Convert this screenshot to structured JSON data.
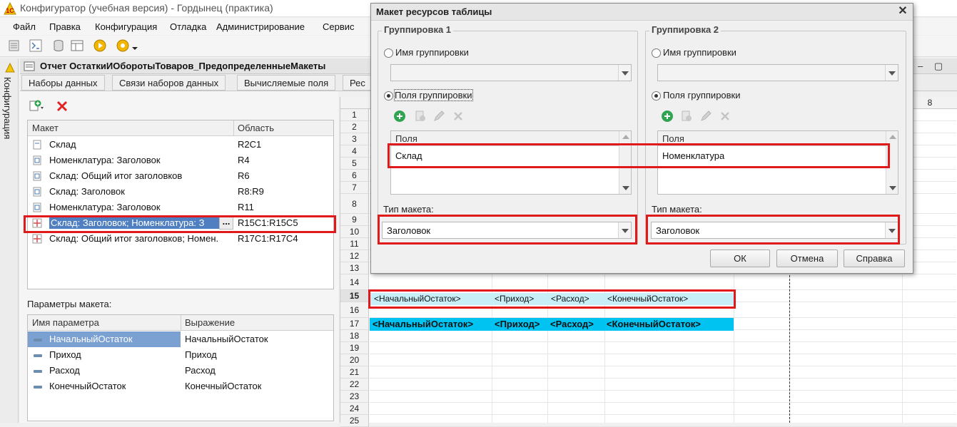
{
  "app": {
    "title": "Конфигуратор (учебная версия) - Гордынец (практика)"
  },
  "menu": [
    "Файл",
    "Правка",
    "Конфигурация",
    "Отладка",
    "Администрирование",
    "Сервис"
  ],
  "side_panel": {
    "label": "Конфигурация"
  },
  "document": {
    "title": "Отчет ОстаткиИОборотыТоваров_ПредопределенныеМакеты",
    "tabs": [
      "Наборы данных",
      "Связи наборов данных",
      "Вычисляемые поля",
      "Рес"
    ]
  },
  "layouts": {
    "columns": [
      "Макет",
      "Область"
    ],
    "rows": [
      {
        "name": "Склад",
        "area": "R2C1"
      },
      {
        "name": "Номенклатура: Заголовок",
        "area": "R4"
      },
      {
        "name": "Склад: Общий итог заголовков",
        "area": "R6"
      },
      {
        "name": "Склад: Заголовок",
        "area": "R8:R9"
      },
      {
        "name": "Номенклатура: Заголовок",
        "area": "R11"
      },
      {
        "name": "Склад: Заголовок; Номенклатура: З",
        "area": "R15C1:R15C5",
        "selected": true
      },
      {
        "name": "Склад: Общий итог заголовков; Номен...",
        "area": "R17C1:R17C4"
      }
    ],
    "ellipsis": "..."
  },
  "params": {
    "label": "Параметры макета:",
    "columns": [
      "Имя параметра",
      "Выражение"
    ],
    "rows": [
      {
        "name": "НачальныйОстаток",
        "expr": "НачальныйОстаток",
        "selected": true
      },
      {
        "name": "Приход",
        "expr": "Приход"
      },
      {
        "name": "Расход",
        "expr": "Расход"
      },
      {
        "name": "КонечныйОстаток",
        "expr": "КонечныйОстаток"
      }
    ]
  },
  "sheet": {
    "col_header": "8",
    "row_numbers": [
      "1",
      "2",
      "3",
      "4",
      "5",
      "6",
      "7",
      "8",
      "9",
      "10",
      "11",
      "12",
      "13",
      "14",
      "15",
      "16",
      "17",
      "18",
      "19",
      "20",
      "21",
      "22",
      "23",
      "24",
      "25"
    ],
    "row15": [
      "<НачальныйОстаток>",
      "<Приход>",
      "<Расход>",
      "<КонечныйОстаток>"
    ],
    "row17": [
      "<НачальныйОстаток>",
      "<Приход>",
      "<Расход>",
      "<КонечныйОстаток>"
    ],
    "colors": {
      "row15_bg": "#c8eef8",
      "row17_bg": "#00c3f2"
    }
  },
  "dialog": {
    "title": "Макет ресурсов таблицы",
    "group1": {
      "label": "Группировка 1",
      "radio_name": "Имя группировки",
      "radio_fields": "Поля группировки",
      "fields_header": "Поля",
      "field_value": "Склад",
      "type_label": "Тип макета:",
      "type_value": "Заголовок"
    },
    "group2": {
      "label": "Группировка 2",
      "radio_name": "Имя группировки",
      "radio_fields": "Поля группировки",
      "fields_header": "Поля",
      "field_value": "Номенклатура",
      "type_label": "Тип макета:",
      "type_value": "Заголовок"
    },
    "buttons": {
      "ok": "ОК",
      "cancel": "Отмена",
      "help": "Справка"
    }
  },
  "highlight_color": "#e01a1a"
}
